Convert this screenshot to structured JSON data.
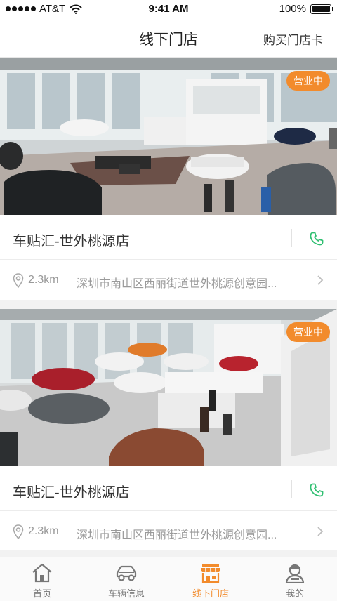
{
  "status_bar": {
    "carrier": "AT&T",
    "time": "9:41 AM",
    "battery": "100%"
  },
  "nav": {
    "title": "线下门店",
    "right_action": "购买门店卡"
  },
  "stores": [
    {
      "name": "车贴汇-世外桃源店",
      "status": "营业中",
      "distance": "2.3km",
      "address": "深圳市南山区西丽街道世外桃源创意园..."
    },
    {
      "name": "车贴汇-世外桃源店",
      "status": "营业中",
      "distance": "2.3km",
      "address": "深圳市南山区西丽街道世外桃源创意园..."
    }
  ],
  "tabs": [
    {
      "label": "首页",
      "icon": "home-icon"
    },
    {
      "label": "车辆信息",
      "icon": "car-icon"
    },
    {
      "label": "线下门店",
      "icon": "store-icon",
      "active": true
    },
    {
      "label": "我的",
      "icon": "profile-icon"
    }
  ],
  "colors": {
    "accent": "#f28b2c",
    "phone": "#2fbf71",
    "muted": "#9a9a9a"
  }
}
